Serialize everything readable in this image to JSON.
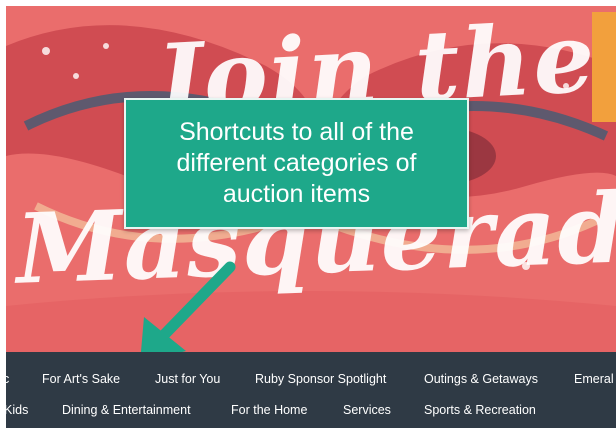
{
  "hero": {
    "script_line1": "Join the",
    "script_line2": "Masquerade"
  },
  "callout": {
    "text": "Shortcuts to all of the different categories of auction items"
  },
  "categories": {
    "row1": [
      "c",
      "For Art's Sake",
      "Just for You",
      "Ruby Sponsor Spotlight",
      "Outings & Getaways",
      "Emeral"
    ],
    "row2": [
      "Kids",
      "Dining & Entertainment",
      "For the Home",
      "Services",
      "Sports & Recreation"
    ]
  },
  "colors": {
    "hero_bg": "#ea6d6c",
    "callout_bg": "#1ea88a",
    "category_bar_bg": "#2f3a45",
    "arrow": "#1ea88a"
  }
}
